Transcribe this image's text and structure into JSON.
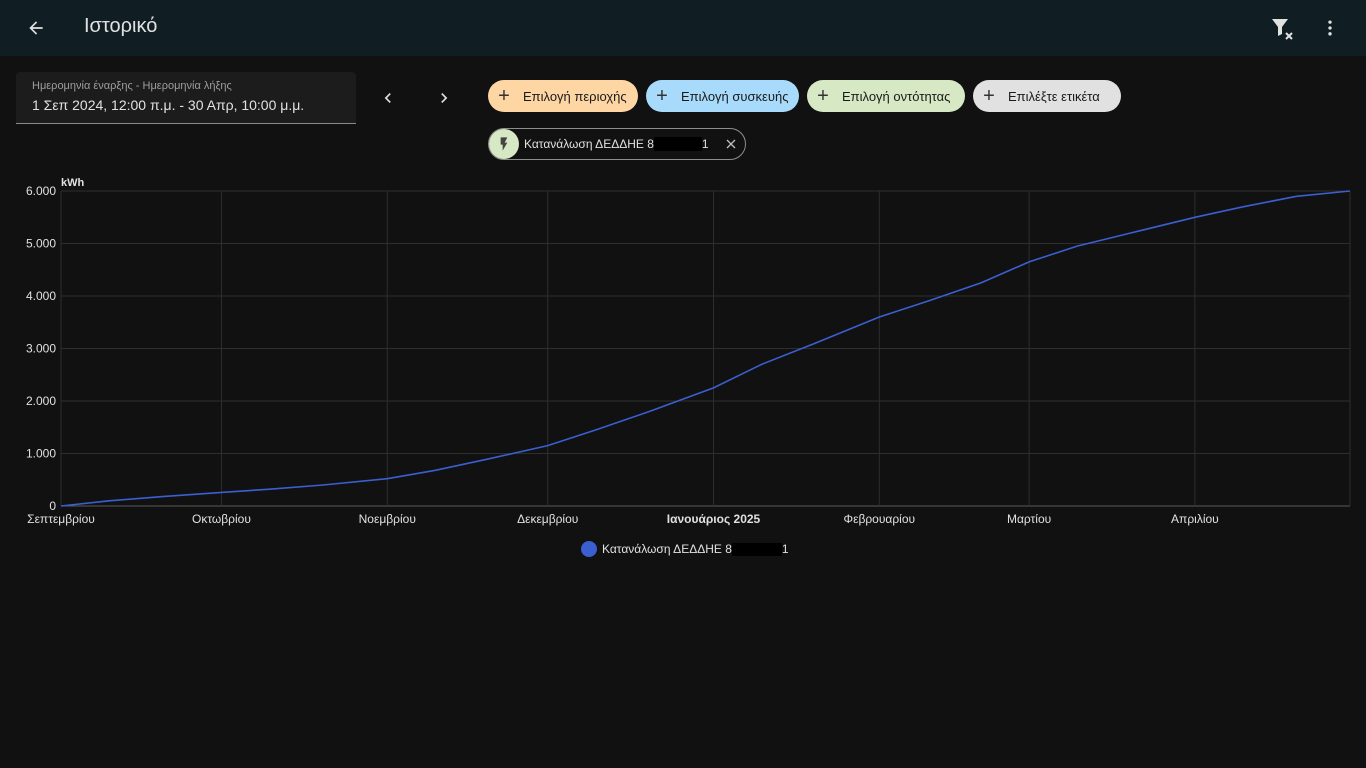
{
  "header": {
    "title": "Ιστορικό",
    "back_icon": "arrow-left-icon",
    "filter_icon": "filter-remove-icon",
    "menu_icon": "dots-vertical-icon"
  },
  "date_range": {
    "label": "Ημερομηνία έναρξης - Ημερομηνία λήξης",
    "value": "1 Σεπ 2024, 12:00 π.μ. - 30 Απρ, 10:00 μ.μ."
  },
  "filters": {
    "area": {
      "label": "Επιλογή περιοχής",
      "color": "#fed6a4"
    },
    "device": {
      "label": "Επιλογή συσκευής",
      "color": "#a8dbfb"
    },
    "entity": {
      "label": "Επιλογή οντότητας",
      "color": "#d7e8c4"
    },
    "label": {
      "label": "Επιλέξτε ετικέτα",
      "color": "#e1e1e1"
    }
  },
  "selected_entity": {
    "name_prefix": "Κατανάλωση ΔΕΔΔΗΕ 8",
    "name_suffix": "1",
    "icon": "flash-icon"
  },
  "chart_data": {
    "type": "line",
    "ylabel": "kWh",
    "ylim": [
      0,
      6000
    ],
    "yticks": [
      "6.000",
      "5.000",
      "4.000",
      "3.000",
      "2.000",
      "1.000",
      "0"
    ],
    "xtick_labels": [
      "Σεπτεμβρίου",
      "Οκτωβρίου",
      "Νοεμβρίου",
      "Δεκεμβρίου",
      "Ιανουάριος 2025",
      "Φεβρουαρίου",
      "Μαρτίου",
      "Απριλίου"
    ],
    "x_start": "2024-09-01",
    "x_end": "2025-04-30",
    "series": [
      {
        "name": "Κατανάλωση ΔΕΔΔΗΕ 8",
        "name_suffix": "1",
        "color": "#3b5fd1",
        "points": [
          [
            "2024-09-01",
            0
          ],
          [
            "2024-09-10",
            100
          ],
          [
            "2024-09-20",
            180
          ],
          [
            "2024-10-01",
            260
          ],
          [
            "2024-10-10",
            320
          ],
          [
            "2024-10-20",
            400
          ],
          [
            "2024-11-01",
            520
          ],
          [
            "2024-11-10",
            680
          ],
          [
            "2024-11-20",
            900
          ],
          [
            "2024-12-01",
            1150
          ],
          [
            "2024-12-10",
            1450
          ],
          [
            "2024-12-20",
            1800
          ],
          [
            "2025-01-01",
            2250
          ],
          [
            "2025-01-10",
            2700
          ],
          [
            "2025-01-20",
            3100
          ],
          [
            "2025-02-01",
            3600
          ],
          [
            "2025-02-10",
            3900
          ],
          [
            "2025-02-20",
            4250
          ],
          [
            "2025-03-01",
            4650
          ],
          [
            "2025-03-10",
            4950
          ],
          [
            "2025-03-20",
            5200
          ],
          [
            "2025-04-01",
            5500
          ],
          [
            "2025-04-10",
            5700
          ],
          [
            "2025-04-20",
            5900
          ],
          [
            "2025-04-30",
            6000
          ]
        ]
      }
    ]
  }
}
